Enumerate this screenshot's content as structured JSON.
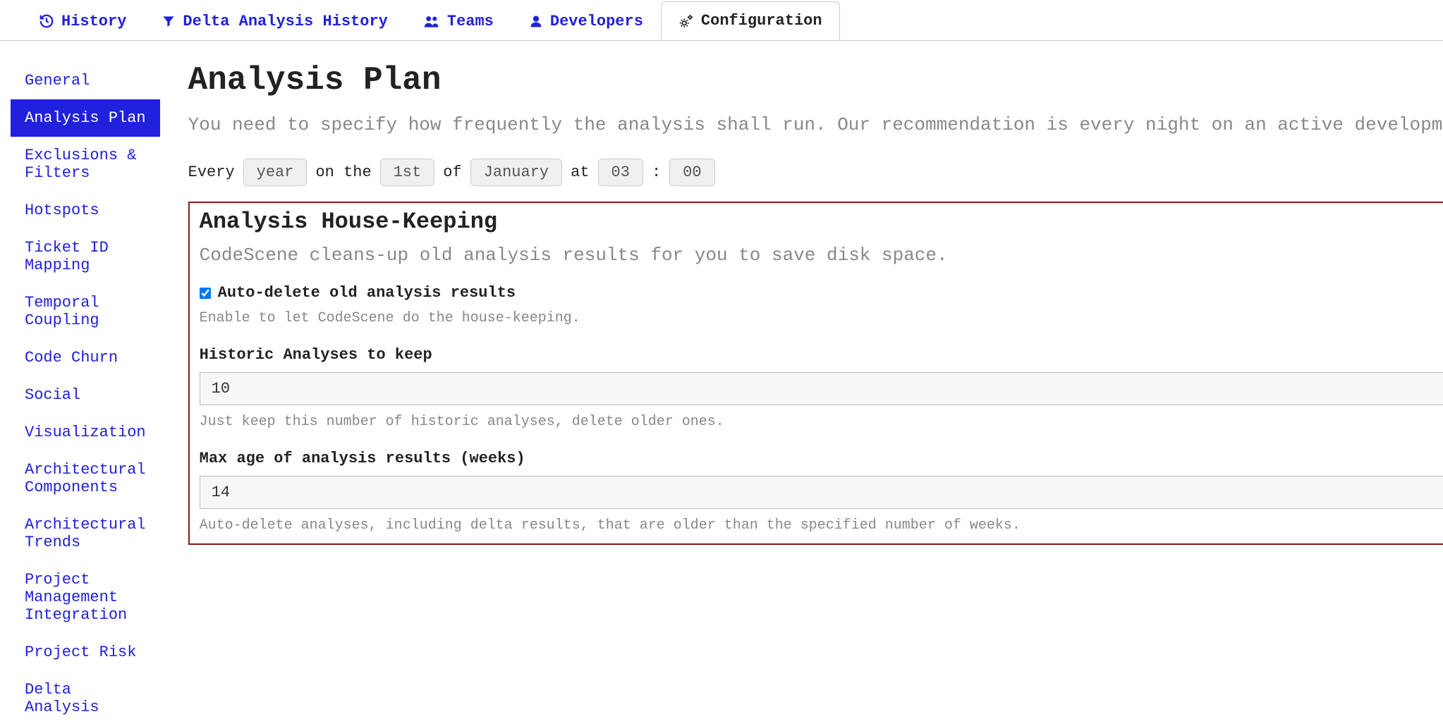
{
  "tabs": {
    "history": "History",
    "delta": "Delta Analysis History",
    "teams": "Teams",
    "developers": "Developers",
    "configuration": "Configuration"
  },
  "sidebar": {
    "items": [
      "General",
      "Analysis Plan",
      "Exclusions & Filters",
      "Hotspots",
      "Ticket ID Mapping",
      "Temporal Coupling",
      "Code Churn",
      "Social",
      "Visualization",
      "Architectural Components",
      "Architectural Trends",
      "Project Management Integration",
      "Project Risk",
      "Delta Analysis"
    ],
    "activeIndex": 1
  },
  "main": {
    "title": "Analysis Plan",
    "description": "You need to specify how frequently the analysis shall run. Our recommendation is every night on an active development project and once a week on stable projects.",
    "schedule": {
      "every_label": "Every",
      "period": "year",
      "on_the_label": "on the",
      "day": "1st",
      "of_label": "of",
      "month": "January",
      "at_label": "at",
      "hour": "03",
      "colon": ":",
      "minute": "00"
    },
    "housekeeping": {
      "title": "Analysis House-Keeping",
      "description": "CodeScene cleans-up old analysis results for you to save disk space.",
      "auto_delete_label": "Auto-delete old analysis results",
      "auto_delete_checked": true,
      "auto_delete_help": "Enable to let CodeScene do the house-keeping.",
      "historic_label": "Historic Analyses to keep",
      "historic_value": "10",
      "historic_help": "Just keep this number of historic analyses, delete older ones.",
      "maxage_label": "Max age of analysis results (weeks)",
      "maxage_value": "14",
      "maxage_help": "Auto-delete analyses, including delta results, that are older than the specified number of weeks."
    }
  }
}
